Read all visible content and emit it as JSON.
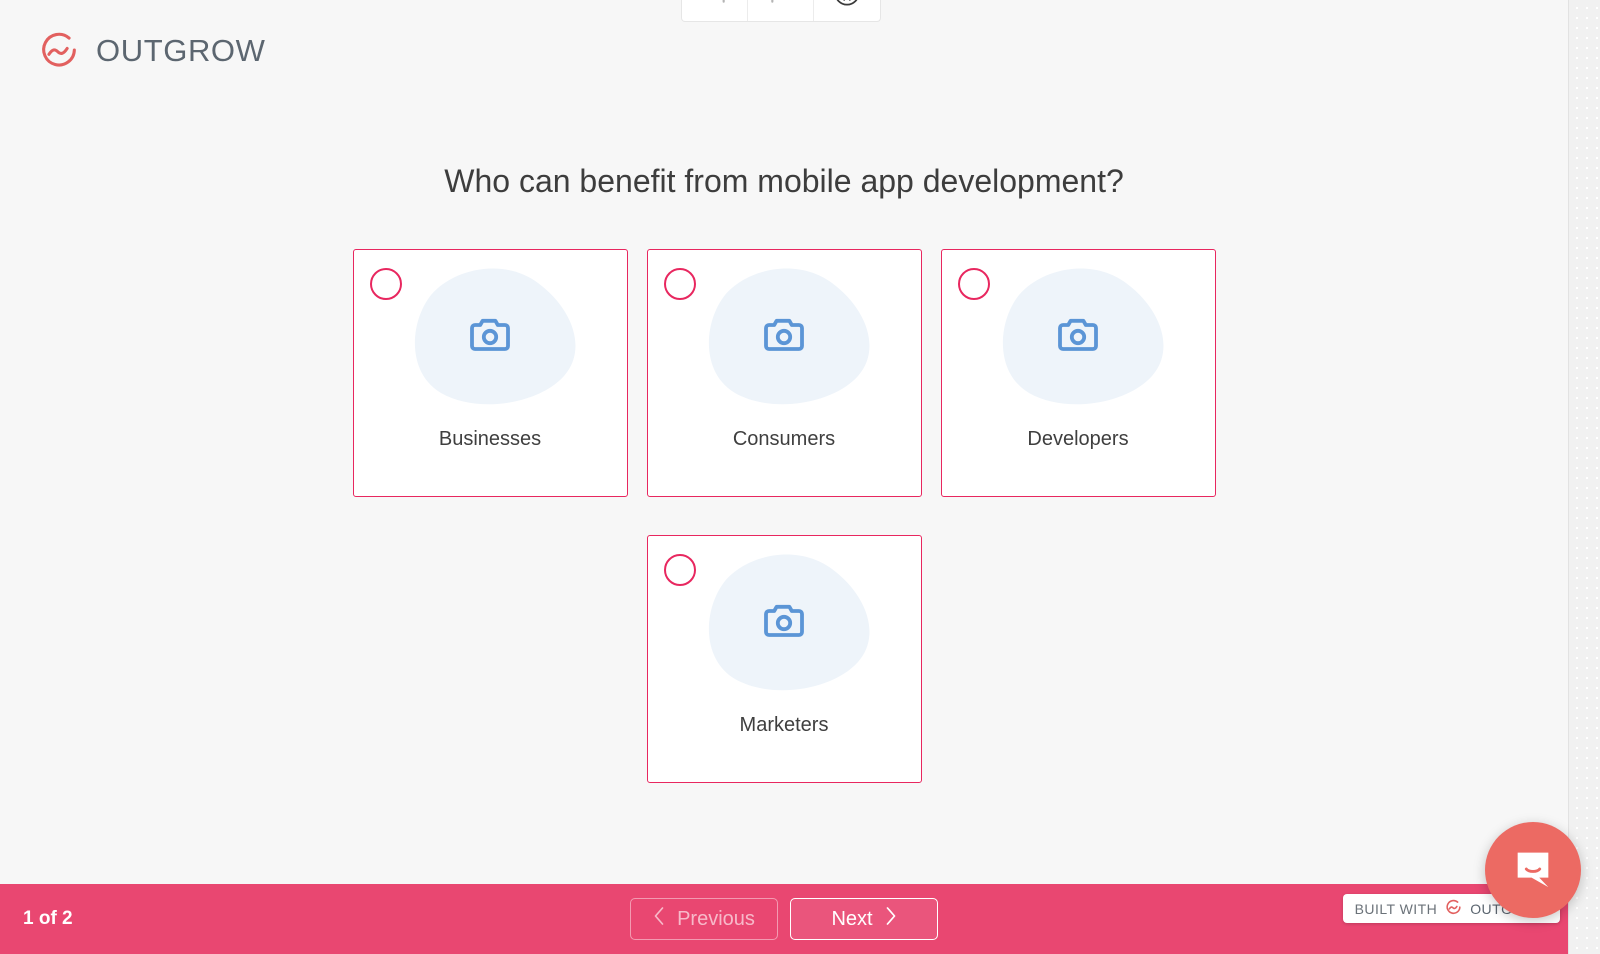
{
  "brand": {
    "logo_text": "OUTGROW",
    "logo_icon": "outgrow-logo-icon",
    "accent_pink": "#e8275f",
    "bar_pink": "#e94771",
    "icon_blue": "#5b95d6",
    "blob_blue": "#eef4fa",
    "page_bg": "#f7f7f7"
  },
  "toolbar": {
    "undo_icon": "undo-icon",
    "redo_icon": "redo-icon",
    "accessibility_icon": "accessibility-icon"
  },
  "quiz": {
    "question": "Who can benefit from mobile app development?",
    "options": [
      {
        "label": "Businesses",
        "selected": false,
        "image_icon": "camera-placeholder-icon"
      },
      {
        "label": "Consumers",
        "selected": false,
        "image_icon": "camera-placeholder-icon"
      },
      {
        "label": "Developers",
        "selected": false,
        "image_icon": "camera-placeholder-icon"
      },
      {
        "label": "Marketers",
        "selected": false,
        "image_icon": "camera-placeholder-icon"
      }
    ]
  },
  "footer": {
    "progress": "1 of 2",
    "previous_label": "Previous",
    "next_label": "Next",
    "previous_icon": "chevron-left-icon",
    "next_icon": "chevron-right-icon",
    "built_with_label": "BUILT WITH",
    "built_brand_label": "OUTGROW",
    "built_logo_icon": "outgrow-logo-icon"
  },
  "chat": {
    "launcher_icon": "chat-bubble-icon"
  }
}
